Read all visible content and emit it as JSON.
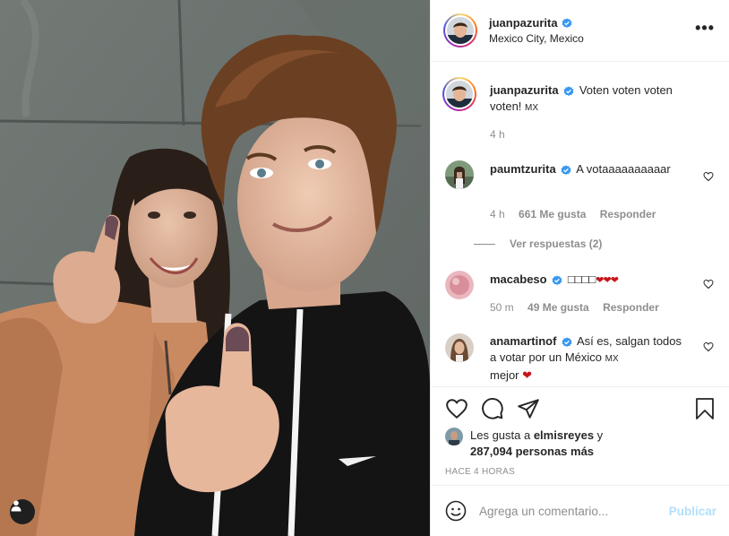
{
  "post": {
    "author": "juanpazurita",
    "location": "Mexico City, Mexico",
    "more_label": "•••"
  },
  "caption": {
    "username": "juanpazurita",
    "text": "Voten voten voten voten! ",
    "flag": "MX",
    "time": "4 h"
  },
  "comments": [
    {
      "username": "paumtzurita",
      "text": "A votaaaaaaaaaar",
      "time": "4 h",
      "likes": "661 Me gusta",
      "reply": "Responder",
      "view_replies": "Ver respuestas (2)"
    },
    {
      "username": "macabeso",
      "text": "□□□□",
      "hearts": "❤❤❤",
      "time": "50 m",
      "likes": "49 Me gusta",
      "reply": "Responder"
    },
    {
      "username": "anamartinof",
      "text": "Así es, salgan todos a votar por un México ",
      "flag": "MX",
      "text_end": "mejor ",
      "heart": "❤"
    }
  ],
  "likes": {
    "prefix": "Les gusta a ",
    "user": "elmisreyes",
    "conj": " y",
    "count": "287,094 personas más"
  },
  "timestamp": "HACE 4 HORAS",
  "add_comment": {
    "placeholder": "Agrega un comentario...",
    "publish": "Publicar"
  },
  "colors": {
    "verified": "#3897f0",
    "muted": "#8e8e8e",
    "publish_disabled": "#b2dffc",
    "heart": "#c4161c"
  }
}
